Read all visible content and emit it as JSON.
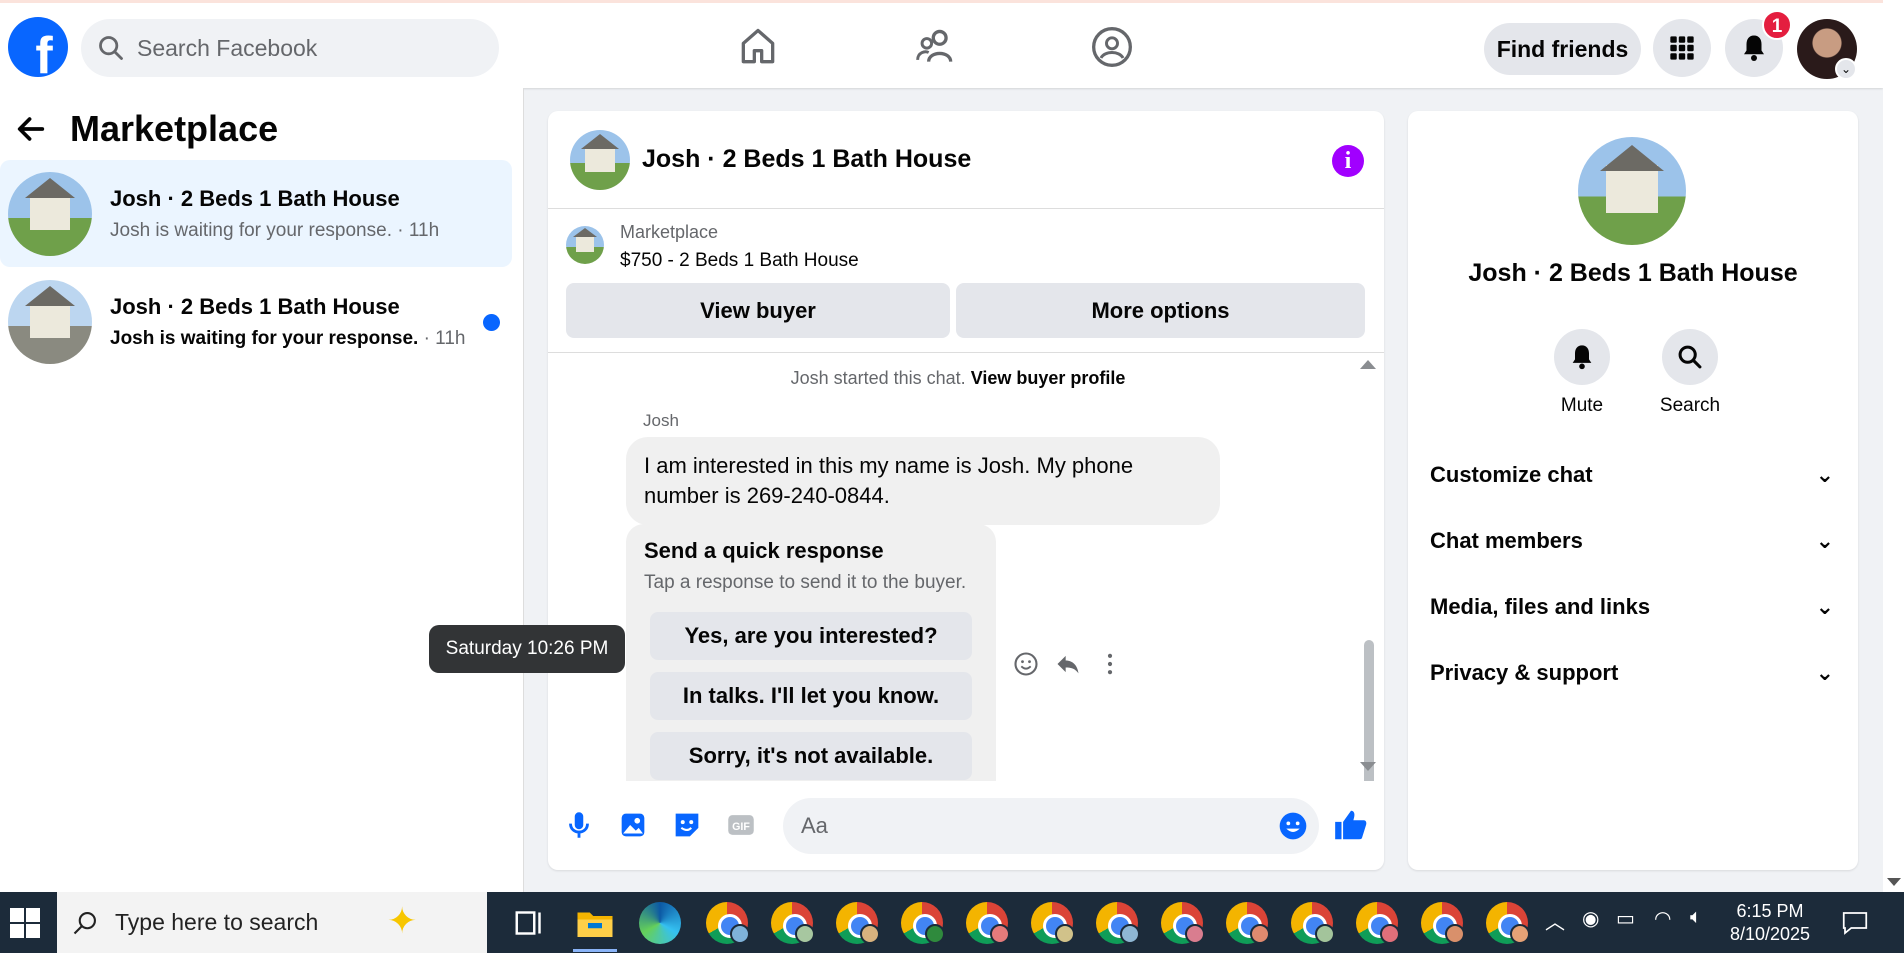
{
  "topbar": {
    "logo": "f",
    "search_placeholder": "Search Facebook",
    "find_friends": "Find friends",
    "notification_count": "1",
    "nav_icons": [
      "home-icon",
      "friends-icon",
      "groups-icon"
    ]
  },
  "sidebar": {
    "title": "Marketplace",
    "conversations": [
      {
        "name": "Josh · 2 Beds 1 Bath House",
        "preview": "Josh is waiting for your response.",
        "time": " · 11h",
        "active": true,
        "unread": false
      },
      {
        "name": "Josh · 2 Beds 1 Bath House",
        "preview": "Josh is waiting for your response.",
        "time": " · 11h",
        "active": false,
        "unread": true
      }
    ]
  },
  "chat": {
    "title": "Josh · 2 Beds 1 Bath House",
    "listing_source": "Marketplace",
    "listing_title": "$750 - 2 Beds 1 Bath House",
    "view_buyer": "View buyer",
    "more_options": "More options",
    "started_text": "Josh started this chat.",
    "view_buyer_profile": "View buyer profile",
    "sender": "Josh",
    "message": "I am interested in this my name is Josh. My phone number is 269-240-0844.",
    "quick_title": "Send a quick response",
    "quick_sub": "Tap a response to send it to the buyer.",
    "quick_responses": [
      "Yes, are you interested?",
      "In talks. I'll let you know.",
      "Sorry, it's not available."
    ],
    "tooltip": "Saturday 10:26 PM",
    "composer_placeholder": "Aa"
  },
  "details": {
    "title": "Josh · 2 Beds 1 Bath House",
    "mute": "Mute",
    "search": "Search",
    "sections": [
      "Customize chat",
      "Chat members",
      "Media, files and links",
      "Privacy & support"
    ]
  },
  "taskbar": {
    "search_placeholder": "Type here to search",
    "time": "6:15 PM",
    "date": "8/10/2025"
  },
  "colors": {
    "brand": "#0866ff",
    "active_bg": "#ebf5ff",
    "badge": "#e41e3f",
    "info": "#a100ff",
    "taskbar": "#1c2b3a"
  }
}
